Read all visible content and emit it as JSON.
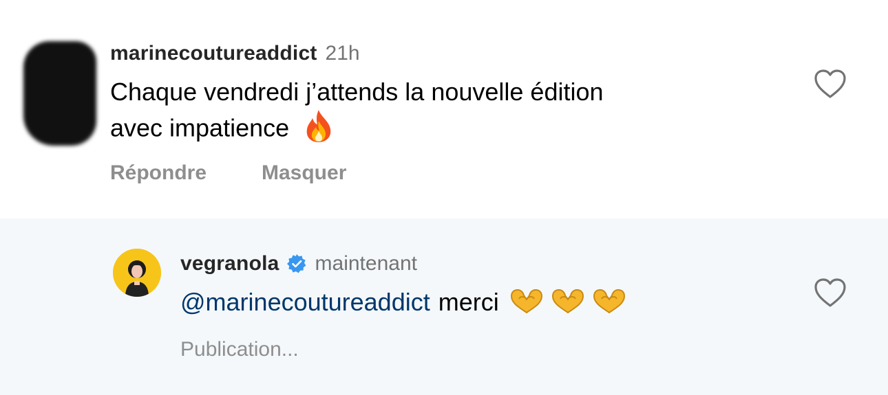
{
  "comments": [
    {
      "username": "marinecoutureaddict",
      "time": "21h",
      "text_line1": "Chaque vendredi j’attends la nouvelle édition",
      "text_line2": "avec impatience",
      "emoji": "fire-emoji",
      "actions": {
        "reply": "Répondre",
        "hide": "Masquer"
      }
    },
    {
      "username": "vegranola",
      "verified": true,
      "time": "maintenant",
      "mention": "@marinecoutureaddict",
      "text": "merci",
      "emoji": "heart-hands-emoji",
      "status": "Publication..."
    }
  ],
  "colors": {
    "reply_background": "#f4f8fb",
    "mention": "#00376b",
    "verified": "#3897f0",
    "secondary_text": "#8e8e8e"
  }
}
